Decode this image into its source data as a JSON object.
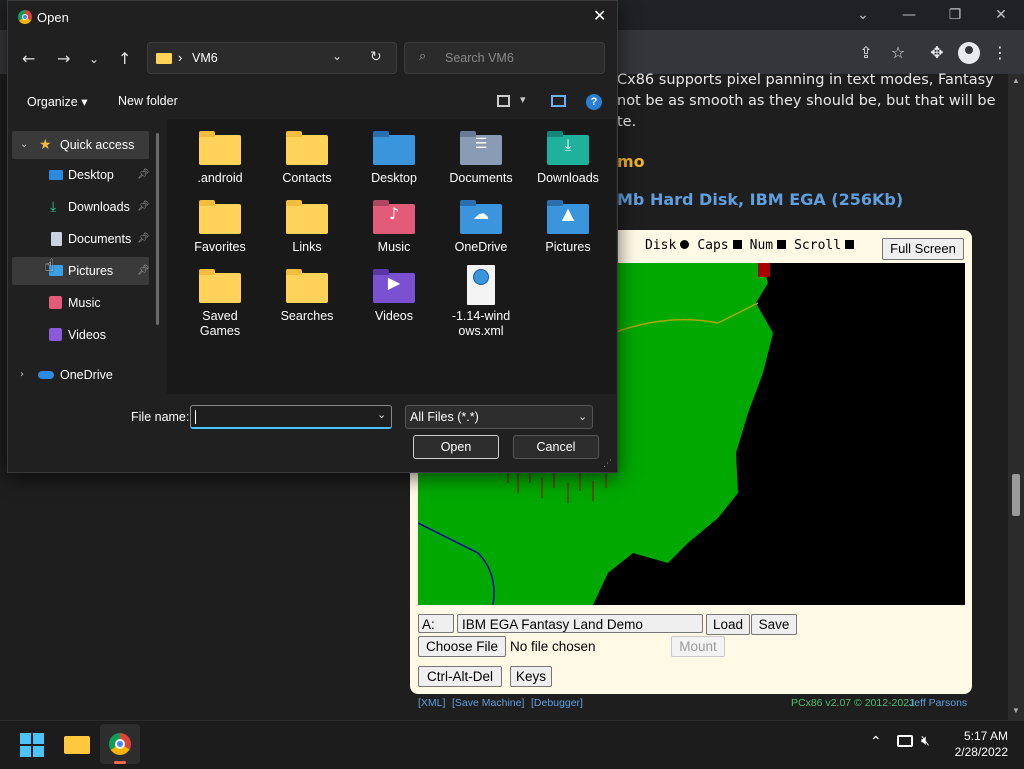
{
  "background": {
    "paragraph": "Cx86 supports pixel panning in text modes, Fantasy not be as smooth as they should be, but that will be te.",
    "paragraph_lines": [
      "Cx86 supports pixel panning in text modes, Fantasy",
      "not be as smooth as they should be, but that will be",
      "te."
    ],
    "heading1": "mo",
    "heading2": "Mb Hard Disk, IBM EGA (256Kb)",
    "status": {
      "disk": "Disk",
      "caps": "Caps",
      "num": "Num",
      "scroll": "Scroll"
    },
    "full_screen": "Full Screen",
    "drive": "A:",
    "disk_select": "IBM EGA Fantasy Land Demo",
    "load": "Load",
    "save": "Save",
    "choose_file": "Choose File",
    "no_file": "No file chosen",
    "mount": "Mount",
    "ctrl_alt_del": "Ctrl-Alt-Del",
    "keys": "Keys",
    "footer": {
      "xml": "[XML]",
      "save_machine": "[Save Machine]",
      "debugger": "[Debugger]",
      "version": "PCx86 v2.07 © 2012-2021",
      "author": "Jeff Parsons"
    }
  },
  "dialog": {
    "title": "Open",
    "address": {
      "separator": "›",
      "folder": "VM6"
    },
    "search_placeholder": "Search VM6",
    "toolbar": {
      "organize": "Organize ▾",
      "new_folder": "New folder"
    },
    "nav": [
      {
        "label": "Quick access",
        "icon": "star-icon"
      },
      {
        "label": "Desktop",
        "icon": "desktop-icon"
      },
      {
        "label": "Downloads",
        "icon": "download-icon"
      },
      {
        "label": "Documents",
        "icon": "documents-icon"
      },
      {
        "label": "Pictures",
        "icon": "pictures-icon"
      },
      {
        "label": "Music",
        "icon": "music-icon"
      },
      {
        "label": "Videos",
        "icon": "videos-icon"
      },
      {
        "label": "OneDrive",
        "icon": "cloud-icon"
      }
    ],
    "files": [
      {
        "label": ".android",
        "icon": "folder-icon"
      },
      {
        "label": "Contacts",
        "icon": "folder-icon"
      },
      {
        "label": "Desktop",
        "icon": "desktop-folder-icon"
      },
      {
        "label": "Documents",
        "icon": "documents-folder-icon"
      },
      {
        "label": "Downloads",
        "icon": "downloads-folder-icon"
      },
      {
        "label": "Favorites",
        "icon": "folder-icon"
      },
      {
        "label": "Links",
        "icon": "folder-icon"
      },
      {
        "label": "Music",
        "icon": "music-folder-icon"
      },
      {
        "label": "OneDrive",
        "icon": "onedrive-folder-icon"
      },
      {
        "label": "Pictures",
        "icon": "pictures-folder-icon"
      },
      {
        "label": "Saved Games",
        "lines": [
          "Saved",
          "Games"
        ],
        "icon": "folder-icon"
      },
      {
        "label": "Searches",
        "icon": "folder-icon"
      },
      {
        "label": "Videos",
        "icon": "videos-folder-icon"
      },
      {
        "label": "-1.14-windows.xml",
        "lines": [
          "-1.14-wind",
          "ows.xml"
        ],
        "icon": "xml-file-icon"
      }
    ],
    "file_name_label": "File name:",
    "file_name_value": "",
    "file_type": "All Files (*.*)",
    "open_button": "Open",
    "cancel_button": "Cancel"
  },
  "taskbar": {
    "time": "5:17 AM",
    "date": "2/28/2022"
  }
}
